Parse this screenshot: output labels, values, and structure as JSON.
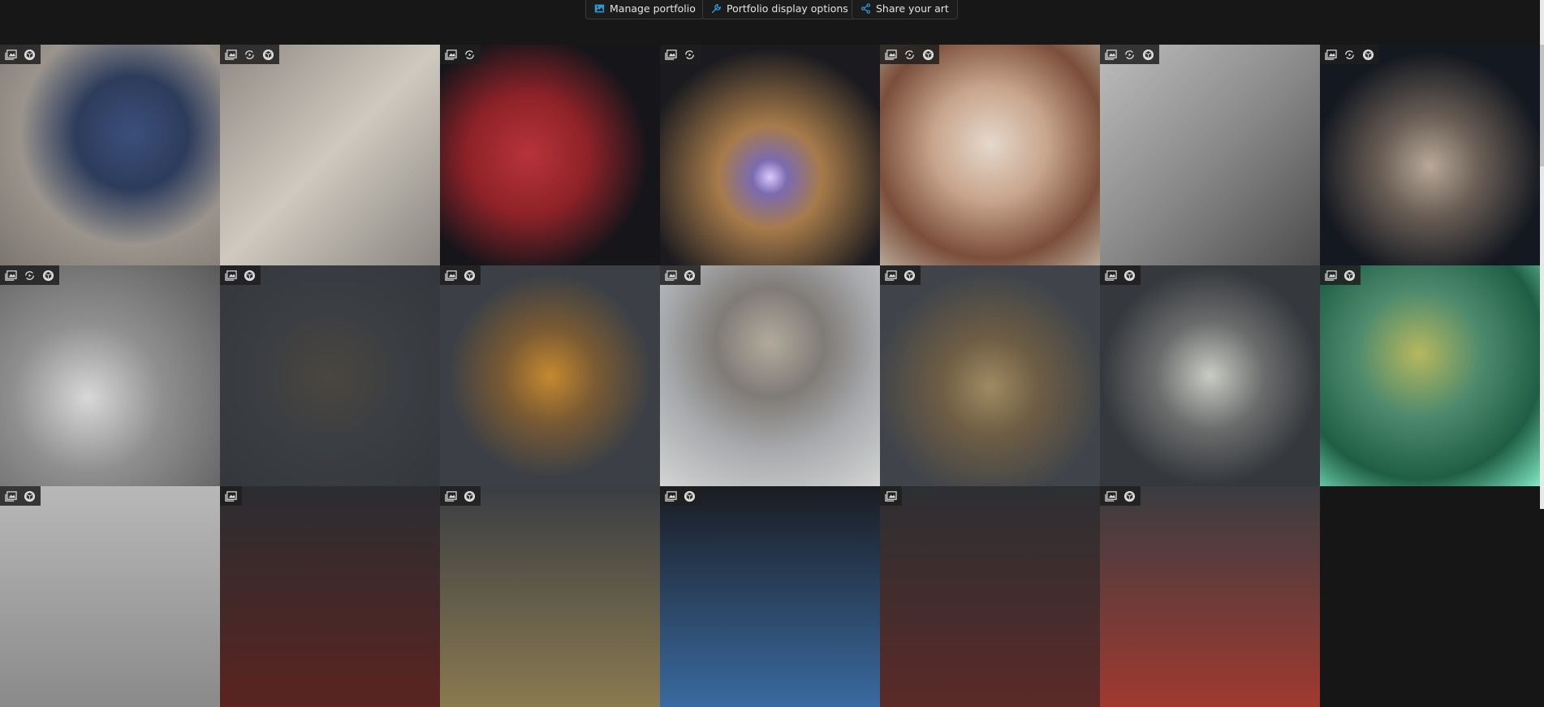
{
  "toolbar": {
    "manage_label": "Manage portfolio",
    "display_label": "Portfolio display options",
    "share_label": "Share your art",
    "accent": "#2a9bd8"
  },
  "tiles": [
    {
      "icons": [
        "gallery",
        "3d"
      ],
      "bg": "radial-gradient(circle at 60% 40%,#3a4f7a 0,#2d3c5c 30%,#9a948d 60%,#7c7670 100%)"
    },
    {
      "icons": [
        "gallery",
        "360",
        "3d"
      ],
      "bg": "linear-gradient(135deg,#8f8983,#cfc9bf 50%,#8a8580)"
    },
    {
      "icons": [
        "gallery",
        "360"
      ],
      "bg": "radial-gradient(circle at 40% 50%,#b8333a 0,#8e2228 35%,#15151a 70%)"
    },
    {
      "icons": [
        "gallery",
        "360"
      ],
      "bg": "radial-gradient(circle at 50% 60%,#d9c8ff 0,#7b6bb0 10%,#a77b4a 30%,#1a1a1f 75%)"
    },
    {
      "icons": [
        "gallery",
        "360",
        "3d"
      ],
      "bg": "radial-gradient(circle at 50% 45%,#e5d8cc 0,#c8a58c 35%,#7a4e3a 70%,#b8a898 100%)"
    },
    {
      "icons": [
        "gallery",
        "360",
        "3d"
      ],
      "bg": "linear-gradient(135deg,#bdbdbd,#8a8a8a 50%,#4c4c4c)"
    },
    {
      "icons": [
        "gallery",
        "360",
        "3d"
      ],
      "bg": "radial-gradient(circle at 50% 55%,#b8a99a 0,#6b5f56 30%,#141820 70%)"
    },
    {
      "icons": [
        "gallery",
        "360",
        "3d"
      ],
      "bg": "radial-gradient(circle at 40% 60%,#d8d8d8 0,#8f8f8f 40%,#5a5a5a 100%)"
    },
    {
      "icons": [
        "gallery",
        "3d"
      ],
      "bg": "radial-gradient(circle at 50% 50%,#4a4640 0,#3a3d42 50%,#34373b 100%)"
    },
    {
      "icons": [
        "gallery",
        "3d"
      ],
      "bg": "radial-gradient(circle at 50% 50%,#c6892f 0,#7a5a33 30%,#3c4046 65%)"
    },
    {
      "icons": [
        "gallery",
        "3d"
      ],
      "bg": "radial-gradient(circle at 50% 35%,#b3aa9c 0,#7f7b77 30%,#a8aaad 60%,#d4d4d4 100%)"
    },
    {
      "icons": [
        "gallery",
        "3d"
      ],
      "bg": "radial-gradient(circle at 50% 55%,#a18a62 0,#6e5d44 30%,#40444a 70%)"
    },
    {
      "icons": [
        "gallery",
        "3d"
      ],
      "bg": "radial-gradient(circle at 50% 50%,#c9cbc5 0,#6a6c6c 35%,#35383c 70%)"
    },
    {
      "icons": [
        "gallery",
        "3d"
      ],
      "bg": "radial-gradient(circle at 45% 40%,#b6b85e 0,#4e8a6d 35%,#1f5e45 70%,#7fe8c4 100%)"
    },
    {
      "icons": [
        "gallery",
        "3d"
      ],
      "bg": "linear-gradient(180deg,#b8b8b8,#8a8a8a)"
    },
    {
      "icons": [
        "gallery"
      ],
      "bg": "linear-gradient(180deg,#2b2d31,#5a2420)"
    },
    {
      "icons": [
        "gallery",
        "3d"
      ],
      "bg": "linear-gradient(180deg,#3a3d42,#8a7a50)"
    },
    {
      "icons": [
        "gallery",
        "3d"
      ],
      "bg": "linear-gradient(180deg,#1a1c22,#3a6aa0)"
    },
    {
      "icons": [
        "gallery"
      ],
      "bg": "linear-gradient(180deg,#2c2f33,#5a2a28)"
    },
    {
      "icons": [
        "gallery",
        "3d"
      ],
      "bg": "linear-gradient(180deg,#3a3c40,#a03a30)"
    },
    {
      "icons": [],
      "bg": "#161616"
    }
  ]
}
